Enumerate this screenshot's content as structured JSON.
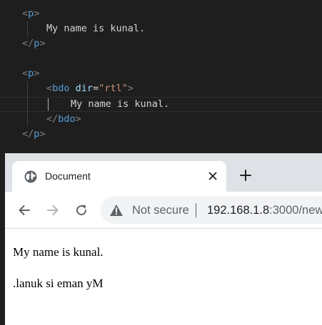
{
  "editor": {
    "lines": {
      "p1_open": {
        "b1": "<",
        "tag": "p",
        "b2": ">"
      },
      "p1_text": "My name is kunal.",
      "p1_close": {
        "b1": "</",
        "tag": "p",
        "b2": ">"
      },
      "p2_open": {
        "b1": "<",
        "tag": "p",
        "b2": ">"
      },
      "bdo_open": {
        "b1": "<",
        "tag": "bdo",
        "attr": "dir",
        "eq": "=",
        "value": "\"rtl\"",
        "b2": ">"
      },
      "bdo_text": "My name is kunal.",
      "bdo_close": {
        "b1": "</",
        "tag": "bdo",
        "b2": ">"
      },
      "p2_close": {
        "b1": "</",
        "tag": "p",
        "b2": ">"
      }
    }
  },
  "browser": {
    "tab": {
      "title": "Document",
      "favicon": "globe-icon",
      "close_glyph": "✕"
    },
    "new_tab_glyph": "+",
    "toolbar": {
      "back_icon": "arrow-left-icon",
      "forward_icon": "arrow-right-icon",
      "reload_icon": "reload-icon"
    },
    "omnibox": {
      "security_icon": "warning-triangle-icon",
      "security_label": "Not secure",
      "url_host": "192.168.1.8",
      "url_rest": ":3000/new"
    },
    "content": {
      "paragraph_1": "My name is kunal.",
      "paragraph_2": ".lanuk si eman yM"
    }
  },
  "colors": {
    "editor_bg": "#1e1e1e",
    "tag": "#569cd6",
    "bracket": "#808080",
    "attr_name": "#9cdcfe",
    "attr_value": "#ce9178",
    "text": "#d4d4d4",
    "tab_strip": "#dee1e6",
    "omnibox_bg": "#f1f3f4"
  }
}
